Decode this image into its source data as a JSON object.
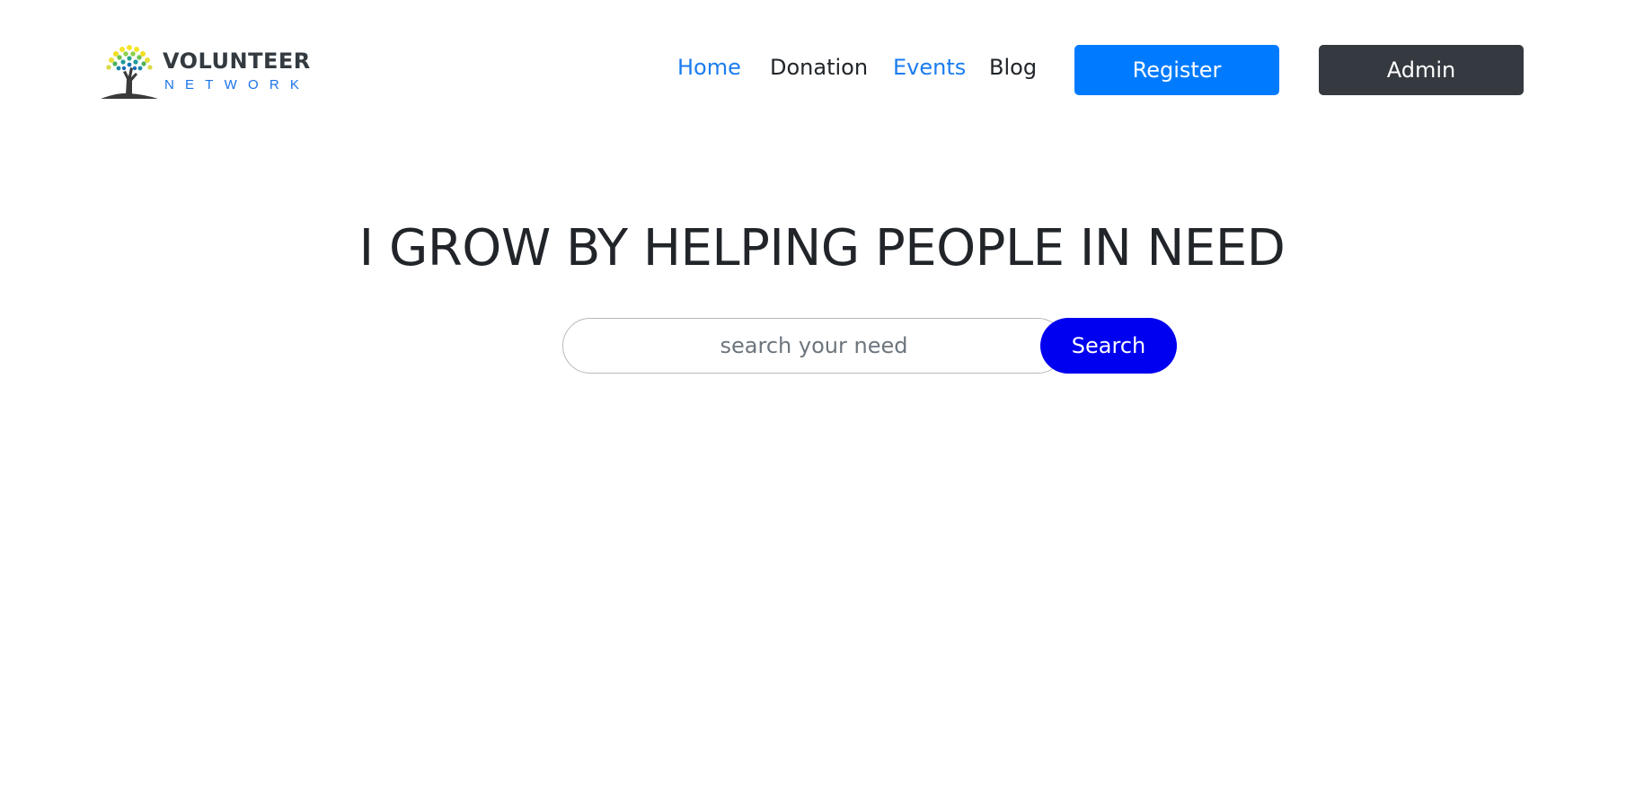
{
  "brand": {
    "name_line1": "VOLUNTEER",
    "name_line2": "NETWORK",
    "logo_icon": "tree-icon"
  },
  "nav": {
    "links": [
      {
        "label": "Home",
        "active": true
      },
      {
        "label": "Donation",
        "active": false
      },
      {
        "label": "Events",
        "active": true
      },
      {
        "label": "Blog",
        "active": false
      }
    ],
    "register_label": "Register",
    "admin_label": "Admin"
  },
  "hero": {
    "title": "I GROW BY HELPING PEOPLE IN NEED"
  },
  "search": {
    "placeholder": "search your need",
    "value": "",
    "button_label": "Search"
  },
  "colors": {
    "link_blue": "#1a7cf0",
    "register_blue": "#007bff",
    "admin_dark": "#343a40",
    "search_button_blue": "#0000f0",
    "text_dark": "#212529"
  }
}
